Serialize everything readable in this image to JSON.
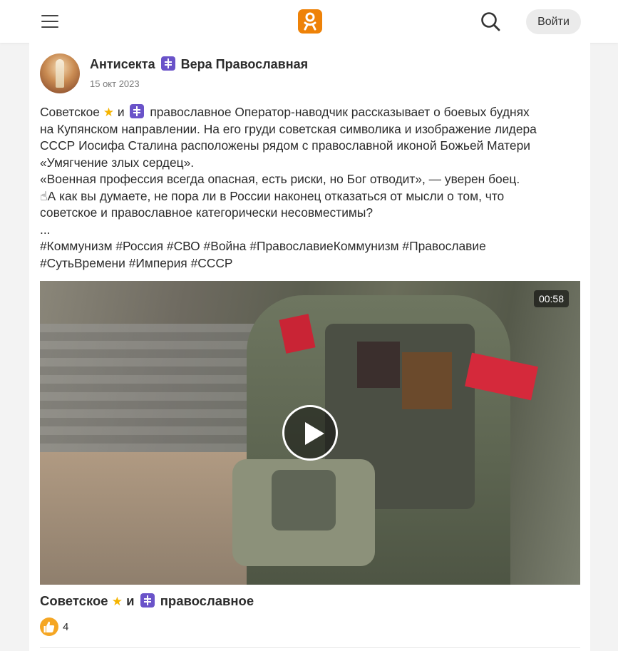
{
  "header": {
    "login_label": "Войти",
    "logo_icon": "ok-logo-icon",
    "brand_color": "#ee8208"
  },
  "post": {
    "author": "Антисекта ☦ Вера Православная",
    "author_name_part1": "Антисекта",
    "author_name_part2": "Вера Православная",
    "date": "15 окт 2023",
    "text_lines": [
      "Советское ⭐ и ☦ православное Оператор-наводчик рассказывает о боевых буднях",
      "на Купянском направлении. На его груди советская символика и изображение лидера",
      "СССР Иосифа Сталина расположены рядом с православной иконой Божьей Матери",
      "«Умягчение злых сердец».",
      "«Военная профессия всегда опасная, есть риски, но Бог отводит», — уверен боец.",
      "☝А как вы думаете, не пора ли в России наконец отказаться от мысли о том, что",
      "советское и православное категорически несовместимы?",
      "..."
    ],
    "line1_part1": "Советское",
    "line1_part2": "и",
    "line1_part3": "православное Оператор-наводчик рассказывает о боевых буднях",
    "line2": "на Купянском направлении. На его груди советская символика и изображение лидера",
    "line3": "СССР Иосифа Сталина расположены рядом с православной иконой Божьей Матери",
    "line4": "«Умягчение злых сердец».",
    "line5": "«Военная профессия всегда опасная, есть риски, но Бог отводит», — уверен боец.",
    "line6": "☝А как вы думаете, не пора ли в России наконец отказаться от мысли о том, что",
    "line7": "советское и православное категорически несовместимы?",
    "line8": "...",
    "hashtags_line1": [
      "#Коммунизм",
      "#Россия",
      "#СВО",
      "#Война",
      "#ПравославиеКоммунизм",
      "#Православие"
    ],
    "hashtags_line2": [
      "#СутьВремени",
      "#Империя",
      "#СССР"
    ],
    "video": {
      "duration": "00:58",
      "title_part1": "Советское",
      "title_part2": "и",
      "title_part3": "православное"
    },
    "likes": "4"
  }
}
